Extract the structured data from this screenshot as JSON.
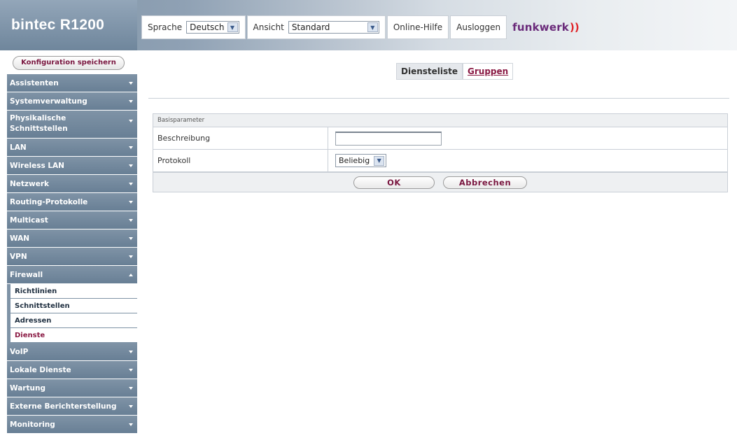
{
  "header": {
    "product_name": "bintec R1200",
    "language_label": "Sprache",
    "language_value": "Deutsch",
    "view_label": "Ansicht",
    "view_value": "Standard",
    "help_label": "Online-Hilfe",
    "logout_label": "Ausloggen",
    "brand": "funkwerk",
    "brand_waves": "))"
  },
  "sidebar": {
    "save_label": "Konfiguration speichern",
    "items": [
      {
        "label": "Assistenten"
      },
      {
        "label": "Systemverwaltung"
      },
      {
        "label": "Physikalische Schnittstellen"
      },
      {
        "label": "LAN"
      },
      {
        "label": "Wireless LAN"
      },
      {
        "label": "Netzwerk"
      },
      {
        "label": "Routing-Protokolle"
      },
      {
        "label": "Multicast"
      },
      {
        "label": "WAN"
      },
      {
        "label": "VPN"
      },
      {
        "label": "Firewall"
      },
      {
        "label": "VoIP"
      },
      {
        "label": "Lokale Dienste"
      },
      {
        "label": "Wartung"
      },
      {
        "label": "Externe Berichterstellung"
      },
      {
        "label": "Monitoring"
      }
    ],
    "firewall_sub": [
      {
        "label": "Richtlinien"
      },
      {
        "label": "Schnittstellen"
      },
      {
        "label": "Adressen"
      },
      {
        "label": "Dienste"
      }
    ]
  },
  "tabs": {
    "active": "Diensteliste",
    "other": "Gruppen"
  },
  "form": {
    "section_title": "Basisparameter",
    "description_label": "Beschreibung",
    "description_value": "",
    "protocol_label": "Protokoll",
    "protocol_value": "Beliebig",
    "ok_label": "OK",
    "cancel_label": "Abbrechen"
  },
  "colors": {
    "nav_bg": "#7f93a6",
    "accent": "#8a1a44",
    "brand": "#6a2a7a"
  }
}
